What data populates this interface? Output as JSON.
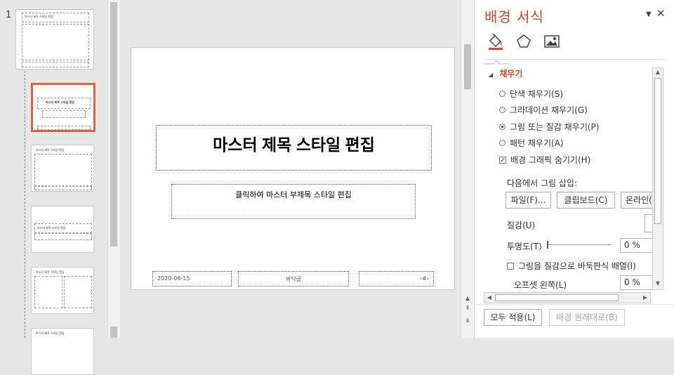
{
  "thumbnails": {
    "master_number": "1",
    "master_title": "마스터 제목 스타일 편집",
    "title_layout_title": "마스터 제목 스타일 편집",
    "content_title": "마스터 제목 스타일 편집",
    "section_title": "마스터 제목 스타일 편집",
    "two_content_title": "마스터 제목 스타일 편집",
    "compare_title": "마스터 제목 스타일 편집"
  },
  "slide": {
    "title": "마스터 제목 스타일 편집",
    "subtitle": "클릭하여 마스터 부제목 스타일 편집",
    "date": "2020-06-15",
    "footer": "바닥글",
    "slide_number": "‹#›"
  },
  "panel": {
    "title": "배경 서식",
    "dropdown_icon": "chevron-down-icon",
    "close_icon": "close-icon",
    "tabs": [
      "fill-tab",
      "effects-tab",
      "picture-tab"
    ],
    "section_fill": "채우기",
    "fill_options": [
      {
        "label": "단색 채우기(S)",
        "selected": false
      },
      {
        "label": "그라데이션 채우기(G)",
        "selected": false
      },
      {
        "label": "그림 또는 질감 채우기(P)",
        "selected": true
      },
      {
        "label": "패턴 채우기(A)",
        "selected": false
      }
    ],
    "hide_bg_graphics": {
      "label": "배경 그래픽 숨기기(H)",
      "checked": true
    },
    "insert_picture_label": "다음에서 그림 삽입:",
    "btn_file": "파일(F)...",
    "btn_clipboard": "클립보드(C)",
    "btn_online": "온라인(E)...",
    "texture_label": "질감(U)",
    "transparency_label": "투명도(T)",
    "transparency_value": "0 %",
    "tile_label": "그림을 질감으로 바둑판식 배열(I)",
    "tile_checked": false,
    "offset_left_label": "오프셋 왼쪽(L)",
    "offset_left_value": "0 %",
    "apply_all": "모두 적용(L)",
    "reset_bg": "배경 원래대로(B)"
  },
  "colors": {
    "accent": "#d24726",
    "selected_thumb_border": "#e0633f"
  }
}
